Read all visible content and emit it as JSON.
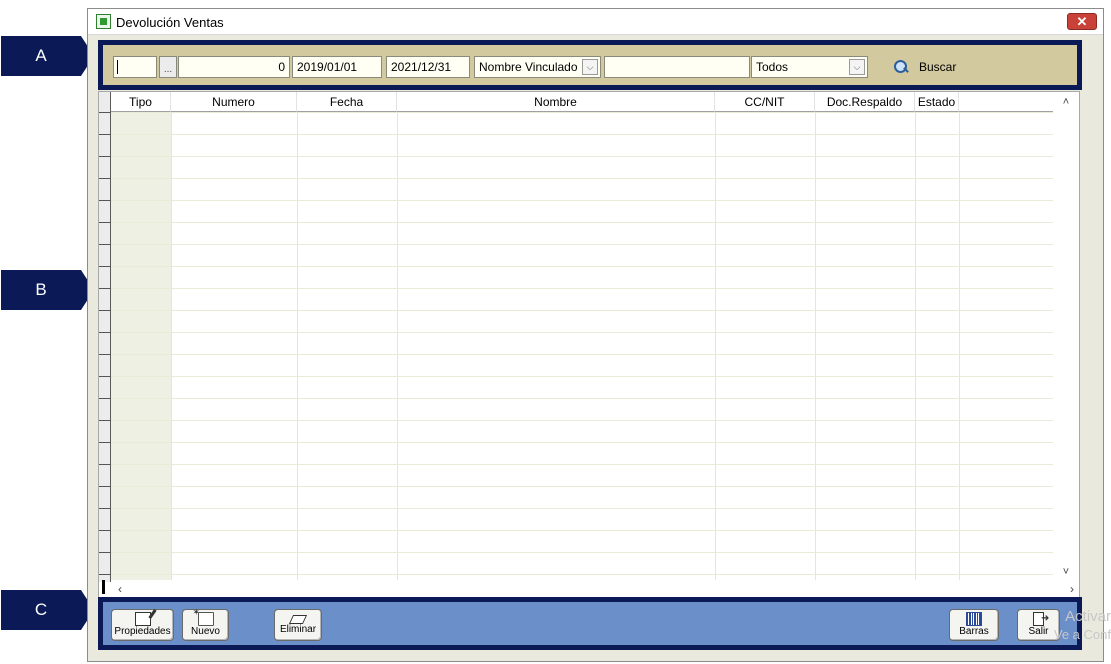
{
  "callouts": [
    "A",
    "B",
    "C"
  ],
  "window": {
    "title": "Devolución Ventas",
    "close_label": "✕"
  },
  "filter": {
    "code_value": "",
    "ellipsis_label": "...",
    "number_value": "0",
    "date_from": "2019/01/01",
    "date_to": "2021/12/31",
    "search_field_selected": "Nombre Vinculado",
    "search_text": "",
    "status_selected": "Todos",
    "search_button_label": "Buscar"
  },
  "grid": {
    "columns": [
      "Tipo",
      "Numero",
      "Fecha",
      "Nombre",
      "CC/NIT",
      "Doc.Respaldo",
      "Estado"
    ],
    "rows": []
  },
  "toolbar": {
    "propiedades_label": "Propiedades",
    "nuevo_label": "Nuevo",
    "eliminar_label": "Eliminar",
    "barras_label": "Barras",
    "salir_label": "Salir"
  },
  "watermark": {
    "line1": "Activar",
    "line2": "Ve a Conf"
  },
  "colors": {
    "callout": "#0b1a57",
    "filter_bar": "#d2c99f",
    "toolbar": "#6b8fc8"
  }
}
